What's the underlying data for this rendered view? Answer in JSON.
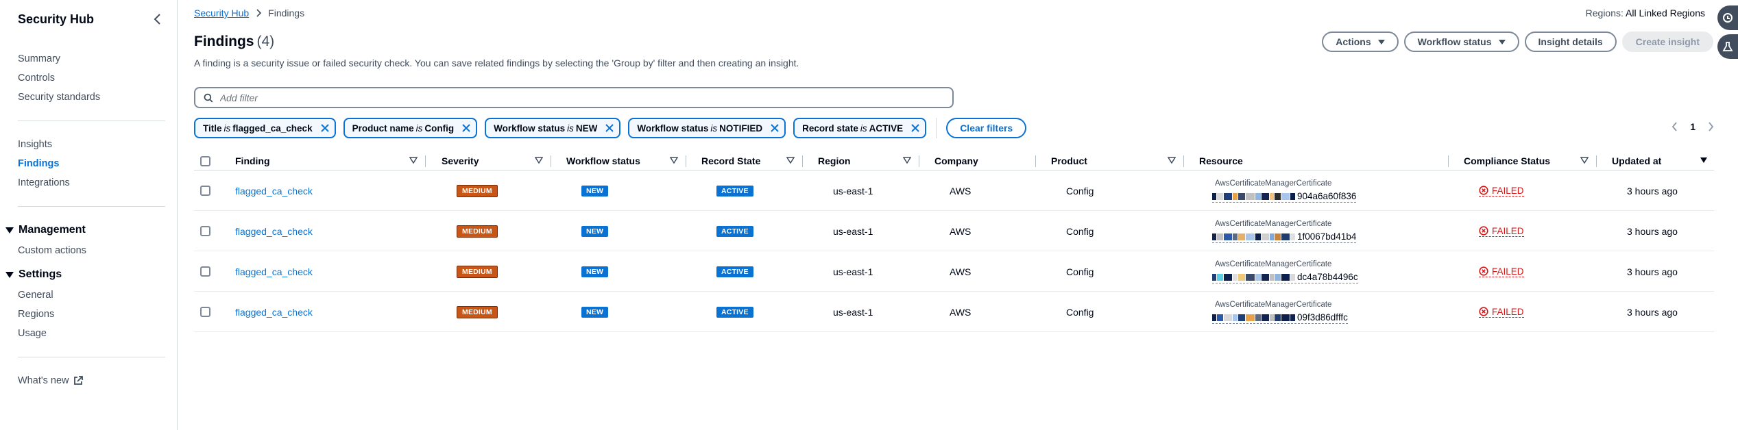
{
  "sidebar": {
    "title": "Security Hub",
    "group1": [
      "Summary",
      "Controls",
      "Security standards"
    ],
    "group2": [
      "Insights",
      "Findings",
      "Integrations"
    ],
    "active": "Findings",
    "management": {
      "title": "Management",
      "items": [
        "Custom actions"
      ]
    },
    "settings": {
      "title": "Settings",
      "items": [
        "General",
        "Regions",
        "Usage"
      ]
    },
    "whats_new": "What's new"
  },
  "breadcrumb": {
    "root": "Security Hub",
    "current": "Findings"
  },
  "regions": {
    "label": "Regions:",
    "value": "All Linked Regions"
  },
  "header": {
    "title": "Findings",
    "count": "(4)",
    "description": "A finding is a security issue or failed security check. You can save related findings by selecting the 'Group by' filter and then creating an insight."
  },
  "actions": {
    "actions": "Actions",
    "workflow_status": "Workflow status",
    "insight_details": "Insight details",
    "create_insight": "Create insight"
  },
  "filter": {
    "placeholder": "Add filter"
  },
  "tokens": [
    {
      "key": "Title",
      "op": "is",
      "value": "flagged_ca_check"
    },
    {
      "key": "Product name",
      "op": "is",
      "value": "Config"
    },
    {
      "key": "Workflow status",
      "op": "is",
      "value": "NEW"
    },
    {
      "key": "Workflow status",
      "op": "is",
      "value": "NOTIFIED"
    },
    {
      "key": "Record state",
      "op": "is",
      "value": "ACTIVE"
    }
  ],
  "clear_filters": "Clear filters",
  "pagination": {
    "page": "1"
  },
  "columns": [
    "Finding",
    "Severity",
    "Workflow status",
    "Record State",
    "Region",
    "Company",
    "Product",
    "Resource",
    "Compliance Status",
    "Updated at"
  ],
  "rows": [
    {
      "finding": "flagged_ca_check",
      "severity": "MEDIUM",
      "workflow": "NEW",
      "record": "ACTIVE",
      "region": "us-east-1",
      "company": "AWS",
      "product": "Config",
      "resource_type": "AwsCertificateManagerCertificate",
      "resource_suffix": "904a6a60f836",
      "compliance": "FAILED",
      "updated": "3 hours ago"
    },
    {
      "finding": "flagged_ca_check",
      "severity": "MEDIUM",
      "workflow": "NEW",
      "record": "ACTIVE",
      "region": "us-east-1",
      "company": "AWS",
      "product": "Config",
      "resource_type": "AwsCertificateManagerCertificate",
      "resource_suffix": "1f0067bd41b4",
      "compliance": "FAILED",
      "updated": "3 hours ago"
    },
    {
      "finding": "flagged_ca_check",
      "severity": "MEDIUM",
      "workflow": "NEW",
      "record": "ACTIVE",
      "region": "us-east-1",
      "company": "AWS",
      "product": "Config",
      "resource_type": "AwsCertificateManagerCertificate",
      "resource_suffix": "dc4a78b4496c",
      "compliance": "FAILED",
      "updated": "3 hours ago"
    },
    {
      "finding": "flagged_ca_check",
      "severity": "MEDIUM",
      "workflow": "NEW",
      "record": "ACTIVE",
      "region": "us-east-1",
      "company": "AWS",
      "product": "Config",
      "resource_type": "AwsCertificateManagerCertificate",
      "resource_suffix": "09f3d86dfffc",
      "compliance": "FAILED",
      "updated": "3 hours ago"
    }
  ],
  "colors": {
    "link": "#0972d3",
    "medium": "#c75617",
    "failed": "#d91515",
    "badge_blue": "#0972d3"
  }
}
